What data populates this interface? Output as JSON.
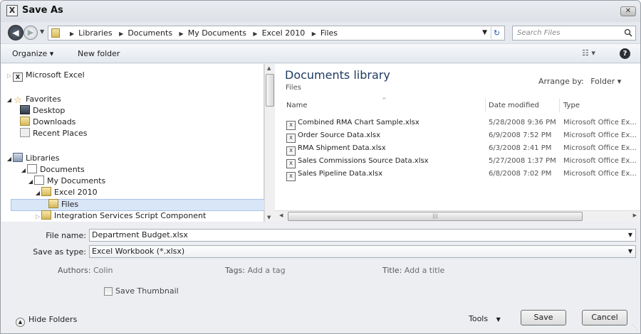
{
  "window": {
    "title": "Save As",
    "app_icon": "excel-icon",
    "close_label": "✕"
  },
  "address": {
    "crumbs": [
      "Libraries",
      "Documents",
      "My Documents",
      "Excel 2010",
      "Files"
    ],
    "search_placeholder": "Search Files"
  },
  "toolbar": {
    "organize": "Organize ▾",
    "new_folder": "New folder",
    "views": "☷ ▾",
    "help": "?"
  },
  "nav_tree": {
    "microsoft_excel": "Microsoft Excel",
    "favorites": "Favorites",
    "desktop": "Desktop",
    "downloads": "Downloads",
    "recent_places": "Recent Places",
    "libraries": "Libraries",
    "documents": "Documents",
    "my_documents": "My Documents",
    "excel_2010": "Excel 2010",
    "files": "Files",
    "integration": "Integration Services Script Component"
  },
  "library": {
    "title": "Documents library",
    "subtitle": "Files",
    "arrange_label": "Arrange by:",
    "arrange_value": "Folder ▾"
  },
  "columns": {
    "name": "Name",
    "date": "Date modified",
    "type": "Type"
  },
  "files": [
    {
      "name": "Combined RMA Chart Sample.xlsx",
      "date": "5/28/2008 9:36 PM",
      "type": "Microsoft Office Ex..."
    },
    {
      "name": "Order Source Data.xlsx",
      "date": "6/9/2008 7:52 PM",
      "type": "Microsoft Office Ex..."
    },
    {
      "name": "RMA Shipment Data.xlsx",
      "date": "6/3/2008 2:41 PM",
      "type": "Microsoft Office Ex..."
    },
    {
      "name": "Sales Commissions Source Data.xlsx",
      "date": "5/27/2008 1:37 PM",
      "type": "Microsoft Office Ex..."
    },
    {
      "name": "Sales Pipeline Data.xlsx",
      "date": "6/8/2008 7:02 PM",
      "type": "Microsoft Office Ex..."
    }
  ],
  "form": {
    "file_name_label": "File name:",
    "file_name_value": "Department Budget.xlsx",
    "save_type_label": "Save as type:",
    "save_type_value": "Excel Workbook (*.xlsx)",
    "authors_label": "Authors:",
    "authors_value": "Colin",
    "tags_label": "Tags:",
    "tags_value": "Add a tag",
    "title_label": "Title:",
    "title_value": "Add a title",
    "thumbnail_label": "Save Thumbnail"
  },
  "footer": {
    "hide_folders": "Hide Folders",
    "tools": "Tools",
    "save": "Save",
    "cancel": "Cancel"
  }
}
